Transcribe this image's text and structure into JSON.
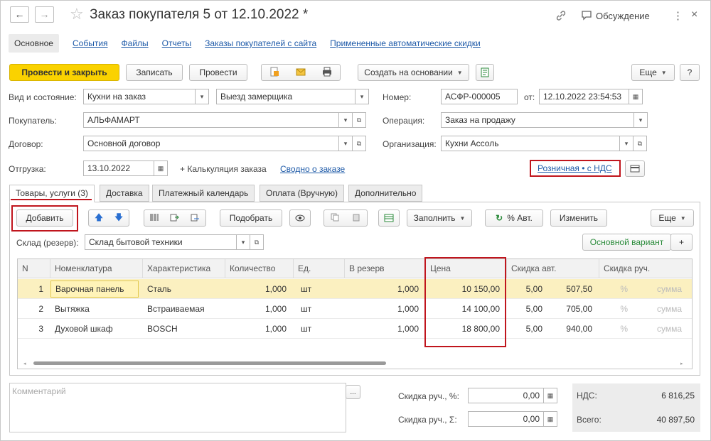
{
  "window": {
    "title": "Заказ покупателя 5 от 12.10.2022 *",
    "discussion_label": "Обсуждение",
    "back_glyph": "←",
    "forward_glyph": "→",
    "star_glyph": "☆",
    "link_glyph": "🔗",
    "menu_glyph": "⋮",
    "close_glyph": "×"
  },
  "section_nav": {
    "active": "Основное",
    "links": [
      "События",
      "Файлы",
      "Отчеты",
      "Заказы покупателей с сайта",
      "Примененные автоматические скидки"
    ]
  },
  "toolbar": {
    "post_close": "Провести и закрыть",
    "save": "Записать",
    "post": "Провести",
    "create_based": "Создать на основании",
    "more": "Еще",
    "help": "?"
  },
  "header_fields": {
    "kind_label": "Вид и состояние:",
    "kind_value": "Кухни на заказ",
    "state_value": "Выезд замерщика",
    "number_label": "Номер:",
    "number_value": "АСФР-000005",
    "from_label": "от:",
    "date_value": "12.10.2022 23:54:53",
    "buyer_label": "Покупатель:",
    "buyer_value": "АЛЬФАМАРТ",
    "operation_label": "Операция:",
    "operation_value": "Заказ на продажу",
    "contract_label": "Договор:",
    "contract_value": "Основной договор",
    "org_label": "Организация:",
    "org_value": "Кухни Ассоль",
    "shipment_label": "Отгрузка:",
    "shipment_value": "13.10.2022",
    "calc_label": "+ Калькуляция заказа",
    "summary_link": "Сводно о заказе",
    "price_type_link": "Розничная • с НДС"
  },
  "tabs": [
    "Товары, услуги (3)",
    "Доставка",
    "Платежный календарь",
    "Оплата (Вручную)",
    "Дополнительно"
  ],
  "table_toolbar": {
    "add": "Добавить",
    "pick": "Подобрать",
    "fill": "Заполнить",
    "auto_percent": "% Авт.",
    "change": "Изменить",
    "more": "Еще",
    "warehouse_label": "Склад (резерв):",
    "warehouse_value": "Склад бытовой техники",
    "main_variant": "Основной вариант",
    "plus": "+"
  },
  "table": {
    "columns": [
      "N",
      "Номенклатура",
      "Характеристика",
      "Количество",
      "Ед.",
      "В резерв",
      "Цена",
      "Скидка авт.",
      "Скидка руч."
    ],
    "rows": [
      {
        "n": "1",
        "name": "Варочная панель",
        "char": "Сталь",
        "qty": "1,000",
        "unit": "шт",
        "reserve": "1,000",
        "price": "10 150,00",
        "auto_pct": "5,00",
        "auto_sum": "507,50",
        "man_pct": "%",
        "man_sum": "сумма"
      },
      {
        "n": "2",
        "name": "Вытяжка",
        "char": "Встраиваемая",
        "qty": "1,000",
        "unit": "шт",
        "reserve": "1,000",
        "price": "14 100,00",
        "auto_pct": "5,00",
        "auto_sum": "705,00",
        "man_pct": "%",
        "man_sum": "сумма"
      },
      {
        "n": "3",
        "name": "Духовой шкаф",
        "char": "BOSCH",
        "qty": "1,000",
        "unit": "шт",
        "reserve": "1,000",
        "price": "18 800,00",
        "auto_pct": "5,00",
        "auto_sum": "940,00",
        "man_pct": "%",
        "man_sum": "сумма"
      }
    ]
  },
  "footer": {
    "comment_placeholder": "Комментарий",
    "comment_btn": "...",
    "disc_pct_label": "Скидка руч., %:",
    "disc_pct_value": "0,00",
    "disc_sum_label": "Скидка руч., Σ:",
    "disc_sum_value": "0,00",
    "vat_label": "НДС:",
    "vat_value": "6 816,25",
    "total_label": "Всего:",
    "total_value": "40 897,50"
  },
  "colors": {
    "primary_button": "#fad200",
    "link": "#1e5aa8",
    "highlight": "#c0151d",
    "selected_row": "#fbf0c0"
  }
}
